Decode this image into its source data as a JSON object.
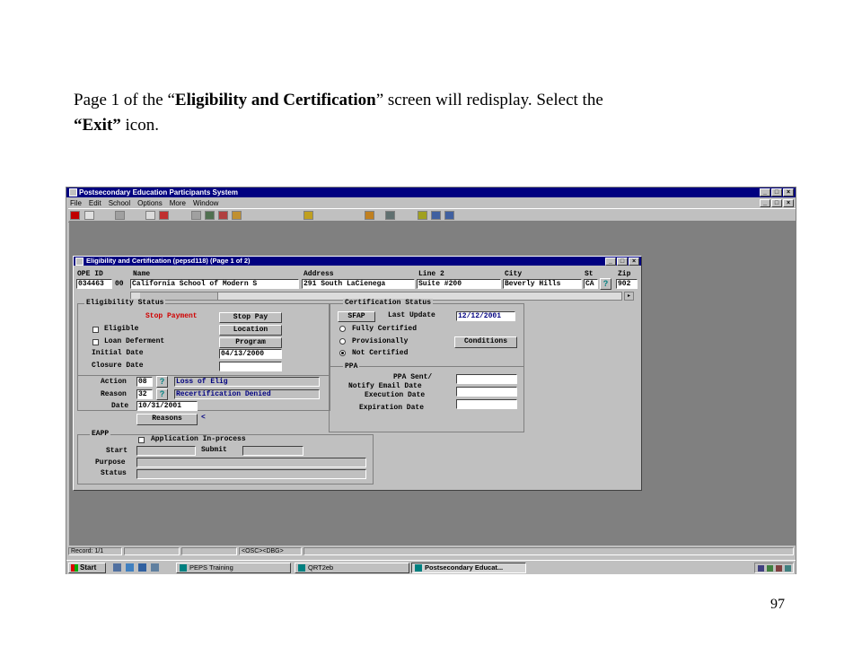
{
  "caption": {
    "part1": "Page 1 of the “",
    "bold1": "Eligibility and Certification",
    "part2": "” screen will redisplay.  Select the ",
    "bold2": "“Exit”",
    "part3": " icon."
  },
  "page_number": "97",
  "app": {
    "title": "Postsecondary Education Participants System",
    "menu": [
      "File",
      "Edit",
      "School",
      "Options",
      "More",
      "Window"
    ]
  },
  "child": {
    "title": "Eligibility and Certification (pepsd118) (Page 1 of 2)",
    "header": {
      "ope_label": "OPE ID",
      "ope_value": "034463",
      "ope_suffix": "00",
      "name_label": "Name",
      "name_value": "California School of Modern S",
      "address_label": "Address",
      "address_value": "291 South LaCienega",
      "line2_label": "Line 2",
      "line2_value": "Suite #200",
      "city_label": "City",
      "city_value": "Beverly Hills",
      "st_label": "St",
      "st_value": "CA",
      "zip_label": "Zip",
      "zip_value": "902"
    },
    "eligibility": {
      "title": "Eligibility Status",
      "stop_payment": "Stop Payment",
      "stop_pay_btn": "Stop Pay",
      "eligible": "Eligible",
      "location_btn": "Location",
      "loan_deferment": "Loan Deferment",
      "program_btn": "Program",
      "initial_date_label": "Initial Date",
      "initial_date_value": "04/13/2000",
      "closure_date_label": "Closure Date",
      "action_label": "Action",
      "action_code": "08",
      "action_desc": "Loss of Elig",
      "reason_label": "Reason",
      "reason_code": "32",
      "reason_desc": "Recertification Denied",
      "date_label": "Date",
      "date_value": "10/31/2001",
      "reasons_btn": "Reasons"
    },
    "certification": {
      "title": "Certification Status",
      "sfap_btn": "SFAP",
      "last_update_label": "Last Update",
      "last_update_value": "12/12/2001",
      "fully_certified": "Fully Certified",
      "provisionally": "Provisionally",
      "conditions_btn": "Conditions",
      "not_certified": "Not Certified"
    },
    "ppa": {
      "title": "PPA",
      "ppa_sent": "PPA Sent/",
      "notify_email": "Notify Email Date",
      "execution_date": "Execution Date",
      "expiration_date": "Expiration Date"
    },
    "eapp": {
      "title": "EAPP",
      "application": "Application In-process",
      "start_label": "Start",
      "submit_label": "Submit",
      "purpose_label": "Purpose",
      "status_label": "Status"
    }
  },
  "statusbar": {
    "record": "Record: 1/1",
    "osc": "<OSC>",
    "dbg": "<DBG>"
  },
  "taskbar": {
    "start": "Start",
    "tasks": [
      "PEPS Training",
      "QRT2eb",
      "Postsecondary Educat..."
    ]
  }
}
